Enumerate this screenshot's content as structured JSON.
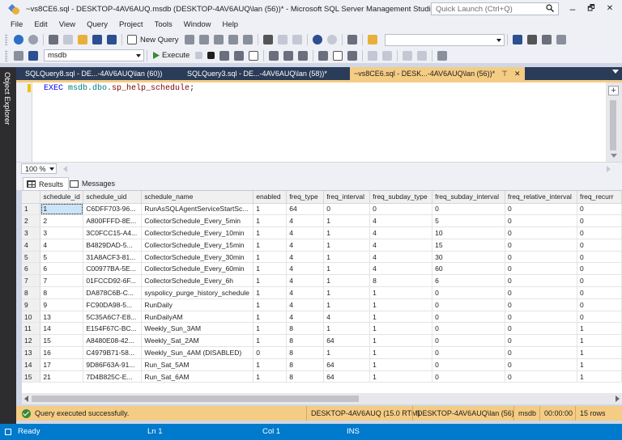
{
  "window": {
    "title": "~vs8CE6.sql - DESKTOP-4AV6AUQ.msdb (DESKTOP-4AV6AUQ\\lan (56))* - Microsoft SQL Server Management Studio",
    "quick_launch_placeholder": "Quick Launch (Ctrl+Q)",
    "minimize": "–",
    "maximize": "🗗",
    "close": "✕"
  },
  "menu": [
    "File",
    "Edit",
    "View",
    "Query",
    "Project",
    "Tools",
    "Window",
    "Help"
  ],
  "toolbar": {
    "new_query": "New Query",
    "database": "msdb",
    "execute": "Execute"
  },
  "side_panel": {
    "label": "Object Explorer"
  },
  "doc_tabs": [
    {
      "label": "SQLQuery8.sql - DE...-4AV6AUQ\\lan (60))"
    },
    {
      "label": "SQLQuery3.sql - DE...-4AV6AUQ\\lan (58))*"
    },
    {
      "label": "~vs8CE6.sql - DESK...-4AV6AUQ\\lan (56))*",
      "pin": "⊤",
      "close": "✕"
    }
  ],
  "editor": {
    "keyword": "EXEC",
    "object": "msdb.dbo.",
    "procedure": "sp_help_schedule",
    "terminator": ";",
    "split_button": "+"
  },
  "zoom": "100 %",
  "result_tabs": [
    "Results",
    "Messages"
  ],
  "grid": {
    "columns": [
      "schedule_id",
      "schedule_uid",
      "schedule_name",
      "enabled",
      "freq_type",
      "freq_interval",
      "freq_subday_type",
      "freq_subday_interval",
      "freq_relative_interval",
      "freq_recurr"
    ],
    "rows": [
      [
        "1",
        "1",
        "C6DFF703-96...",
        "RunAsSQLAgentServiceStartSc...",
        "1",
        "64",
        "0",
        "0",
        "0",
        "0",
        "0"
      ],
      [
        "2",
        "2",
        "A800FFFD-8E...",
        "CollectorSchedule_Every_5min",
        "1",
        "4",
        "1",
        "4",
        "5",
        "0",
        "0"
      ],
      [
        "3",
        "3",
        "3C0FCC15-A4...",
        "CollectorSchedule_Every_10min",
        "1",
        "4",
        "1",
        "4",
        "10",
        "0",
        "0"
      ],
      [
        "4",
        "4",
        "B4829DAD-5...",
        "CollectorSchedule_Every_15min",
        "1",
        "4",
        "1",
        "4",
        "15",
        "0",
        "0"
      ],
      [
        "5",
        "5",
        "31A8ACF3-81...",
        "CollectorSchedule_Every_30min",
        "1",
        "4",
        "1",
        "4",
        "30",
        "0",
        "0"
      ],
      [
        "6",
        "6",
        "C00977BA-5E...",
        "CollectorSchedule_Every_60min",
        "1",
        "4",
        "1",
        "4",
        "60",
        "0",
        "0"
      ],
      [
        "7",
        "7",
        "01FCCD92-6F...",
        "CollectorSchedule_Every_6h",
        "1",
        "4",
        "1",
        "8",
        "6",
        "0",
        "0"
      ],
      [
        "8",
        "8",
        "DA878C6B-C...",
        "syspolicy_purge_history_schedule",
        "1",
        "4",
        "1",
        "1",
        "0",
        "0",
        "0"
      ],
      [
        "9",
        "9",
        "FC90DA98-5...",
        "RunDaily",
        "1",
        "4",
        "1",
        "1",
        "0",
        "0",
        "0"
      ],
      [
        "10",
        "13",
        "5C35A6C7-E8...",
        "RunDailyAM",
        "1",
        "4",
        "4",
        "1",
        "0",
        "0",
        "0"
      ],
      [
        "11",
        "14",
        "E154F67C-BC...",
        "Weekly_Sun_3AM",
        "1",
        "8",
        "1",
        "1",
        "0",
        "0",
        "1"
      ],
      [
        "12",
        "15",
        "A8480E08-42...",
        "Weekly_Sat_2AM",
        "1",
        "8",
        "64",
        "1",
        "0",
        "0",
        "1"
      ],
      [
        "13",
        "16",
        "C4979B71-58...",
        "Weekly_Sun_4AM (DISABLED)",
        "0",
        "8",
        "1",
        "1",
        "0",
        "0",
        "1"
      ],
      [
        "14",
        "17",
        "9D86F63A-91...",
        "Run_Sat_5AM",
        "1",
        "8",
        "64",
        "1",
        "0",
        "0",
        "1"
      ],
      [
        "15",
        "21",
        "7D4B825C-E...",
        "Run_Sat_6AM",
        "1",
        "8",
        "64",
        "1",
        "0",
        "0",
        "1"
      ]
    ]
  },
  "query_status": {
    "message": "Query executed successfully.",
    "server": "DESKTOP-4AV6AUQ (15.0 RTM)",
    "user": "DESKTOP-4AV6AUQ\\lan (56)",
    "database": "msdb",
    "elapsed": "00:00:00",
    "rows": "15 rows"
  },
  "status_bar": {
    "state": "Ready",
    "line": "Ln 1",
    "col": "Col 1",
    "mode": "INS"
  },
  "colors": {
    "accent": "#007acc",
    "tab_active": "#f5cc84",
    "tab_bar": "#2b3c59",
    "success": "#388a34"
  }
}
